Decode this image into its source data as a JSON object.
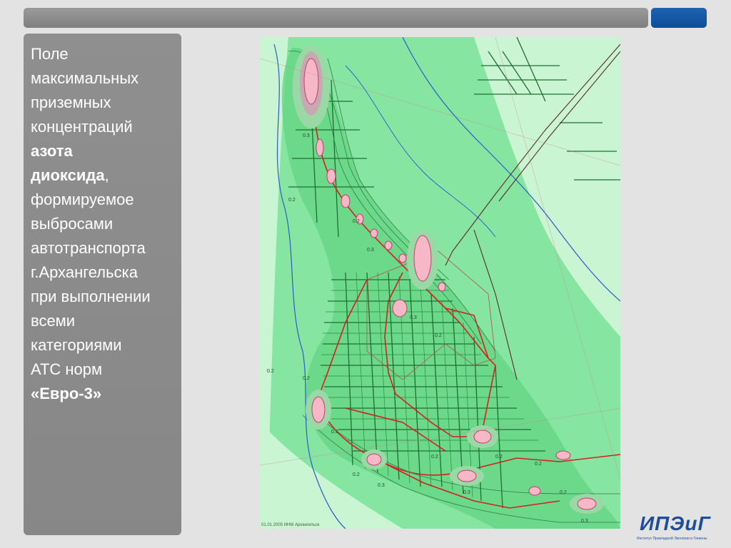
{
  "slide": {
    "description": {
      "line1": "Поле",
      "line2": "максимальных",
      "line3": "приземных",
      "line4": "концентраций",
      "bold1": "азота",
      "bold2": "диоксида",
      "comma": ",",
      "line5": "формируемое",
      "line6": "выбросами",
      "line7": "автотранспорта",
      "line8": "г.Архангельска",
      "line9": "при выполнении",
      "line10": "всеми",
      "line11": "категориями",
      "line12": "АТС норм",
      "bold3": "«Евро-3»"
    },
    "map": {
      "contour_labels": [
        "0.3",
        "0.2",
        "0.2",
        "0.3",
        "0.2",
        "0.3",
        "0.2",
        "0.3",
        "0.2",
        "0.3",
        "0.2",
        "0.2",
        "0.3",
        "0.2",
        "0.3",
        "0.2",
        "0.2"
      ],
      "caption": "01.01.2005 ИНМ Архангельск"
    },
    "logo": {
      "text": "ИПЭиГ",
      "subtitle": "Институт Прикладной Экологии и Гигиены"
    },
    "colors": {
      "top_bar": "#8a8a8a",
      "accent": "#0d4c96",
      "panel": "#8b8b8b",
      "map_background": "#7ee39a",
      "hotspot": "#f6b8c6",
      "road": "#d42020"
    }
  }
}
